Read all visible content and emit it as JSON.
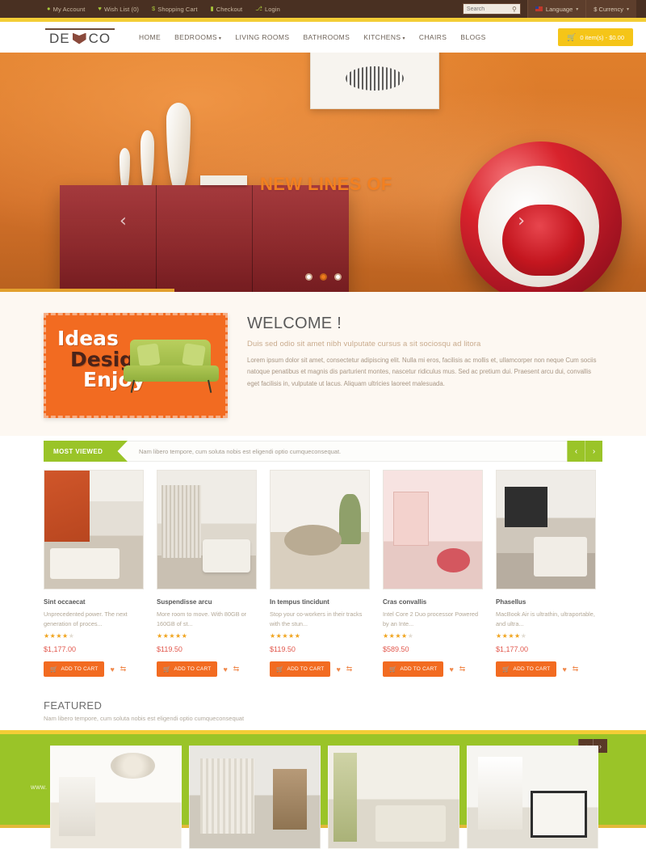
{
  "topbar": {
    "links": [
      {
        "icon": "user-icon",
        "glyph": "●",
        "label": "My Account"
      },
      {
        "icon": "heart-icon",
        "glyph": "♥",
        "label": "Wish List (0)"
      },
      {
        "icon": "dollar-icon",
        "glyph": "$",
        "label": "Shopping Cart"
      },
      {
        "icon": "checkout-icon",
        "glyph": "▮",
        "label": "Checkout"
      },
      {
        "icon": "login-icon",
        "glyph": "⎇",
        "label": "Login"
      }
    ],
    "search_placeholder": "Search",
    "search_value": "",
    "search_icon": "magnifier-icon",
    "language_label": "Language",
    "currency_label": "$ Currency",
    "caret": "▾"
  },
  "header": {
    "logo_left": "DE",
    "logo_right": "CO",
    "nav": [
      {
        "label": "HOME",
        "dropdown": false
      },
      {
        "label": "BEDROOMS",
        "dropdown": true
      },
      {
        "label": "LIVING ROOMS",
        "dropdown": false
      },
      {
        "label": "BATHROOMS",
        "dropdown": false
      },
      {
        "label": "KITCHENS",
        "dropdown": true
      },
      {
        "label": "CHAIRS",
        "dropdown": false
      },
      {
        "label": "BLOGS",
        "dropdown": false
      }
    ],
    "dropdown_caret": "▾",
    "cart_label": "0 item(s) - $0.00",
    "cart_icon": "shopping-cart-icon"
  },
  "hero": {
    "title": "NEW LINES OF",
    "prev_arrow": "‹",
    "next_arrow": "›",
    "dots": [
      {
        "active": false
      },
      {
        "active": true
      },
      {
        "active": false
      }
    ]
  },
  "promo": {
    "line1": "Ideas",
    "line2": "Design",
    "line3": "Enjoy"
  },
  "welcome": {
    "title": "WELCOME !",
    "subtitle": "Duis sed odio sit amet nibh vulputate cursus a sit sociosqu ad litora",
    "body": "Lorem ipsum dolor sit amet, consectetur adipiscing elit. Nulla mi eros, facilisis ac mollis et, ullamcorper non neque Cum sociis natoque penatibus et magnis dis parturient montes, nascetur ridiculus mus. Sed ac pretium dui. Praesent arcu dui, convallis eget facilisis in, vulputate ut lacus. Aliquam ultricies laoreet malesuada."
  },
  "most_viewed": {
    "tag": "MOST VIEWED",
    "subtitle": "Nam libero tempore, cum soluta nobis est eligendi optio cumqueconsequat.",
    "prev_arrow": "‹",
    "next_arrow": "›"
  },
  "products": [
    {
      "name": "Sint occaecat",
      "description": "Unprecedented power. The next generation of proces...",
      "rating": 4,
      "price": "$1,177.00",
      "add_label": "ADD TO CART"
    },
    {
      "name": "Suspendisse arcu",
      "description": "More room to move. With 80GB or 160GB of st...",
      "rating": 5,
      "price": "$119.50",
      "add_label": "ADD TO CART"
    },
    {
      "name": "In tempus tincidunt",
      "description": "Stop your co-workers in their tracks with the stun...",
      "rating": 5,
      "price": "$119.50",
      "add_label": "ADD TO CART"
    },
    {
      "name": "Cras convallis",
      "description": "Intel Core 2 Duo processor Powered by an Inte...",
      "rating": 4,
      "price": "$589.50",
      "add_label": "ADD TO CART"
    },
    {
      "name": "Phasellus",
      "description": "MacBook Air is ultrathin, ultraportable, and ultra...",
      "rating": 4,
      "price": "$1,177.00",
      "add_label": "ADD TO CART"
    }
  ],
  "product_icons": {
    "cart": "Ὥ2",
    "wishlist": "♥",
    "compare": "⇄"
  },
  "featured": {
    "title": "FEATURED",
    "subtitle": "Nam libero tempore, cum soluta nobis est eligendi optio cumqueconsequat",
    "prev_arrow": "‹",
    "next_arrow": "›",
    "items": [
      {
        "alt": "white-room-with-chandelier"
      },
      {
        "alt": "grey-curtain-interior"
      },
      {
        "alt": "green-curtain-bedroom"
      },
      {
        "alt": "white-room-with-framed-art"
      }
    ]
  },
  "watermark": "www.",
  "colors": {
    "topbar": "#493022",
    "accent_orange": "#f26b21",
    "accent_green": "#9ac428",
    "accent_yellow": "#f5c518",
    "price_red": "#e2574c"
  }
}
